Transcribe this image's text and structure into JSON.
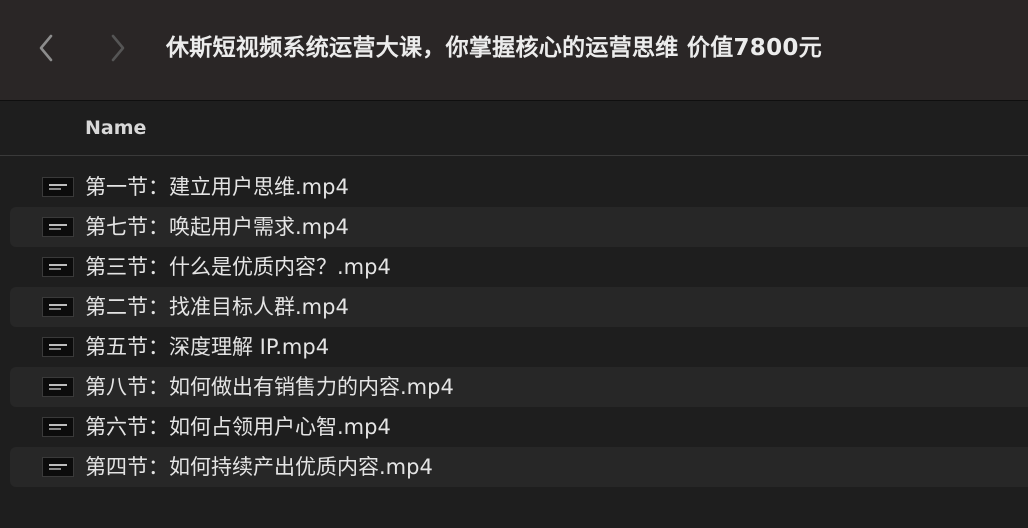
{
  "window": {
    "title": "休斯短视频系统运营大课，你掌握核心的运营思维 价值7800元"
  },
  "toolbar": {
    "back_icon": "chevron-left-icon",
    "forward_icon": "chevron-right-icon"
  },
  "columns": {
    "name": "Name"
  },
  "files": [
    {
      "name": "第一节：建立用户思维.mp4",
      "icon": "video-file-icon"
    },
    {
      "name": "第七节：唤起用户需求.mp4",
      "icon": "video-file-icon"
    },
    {
      "name": "第三节：什么是优质内容？.mp4",
      "icon": "video-file-icon"
    },
    {
      "name": "第二节：找准目标人群.mp4",
      "icon": "video-file-icon"
    },
    {
      "name": "第五节：深度理解 IP.mp4",
      "icon": "video-file-icon"
    },
    {
      "name": "第八节：如何做出有销售力的内容.mp4",
      "icon": "video-file-icon"
    },
    {
      "name": "第六节：如何占领用户心智.mp4",
      "icon": "video-file-icon"
    },
    {
      "name": "第四节：如何持续产出优质内容.mp4",
      "icon": "video-file-icon"
    }
  ],
  "colors": {
    "background": "#1e1e1e",
    "titlebar": "#2a2626",
    "row_alt": "#272727",
    "text": "#e4e4e4",
    "icon_dim": "#6b6b6b"
  }
}
